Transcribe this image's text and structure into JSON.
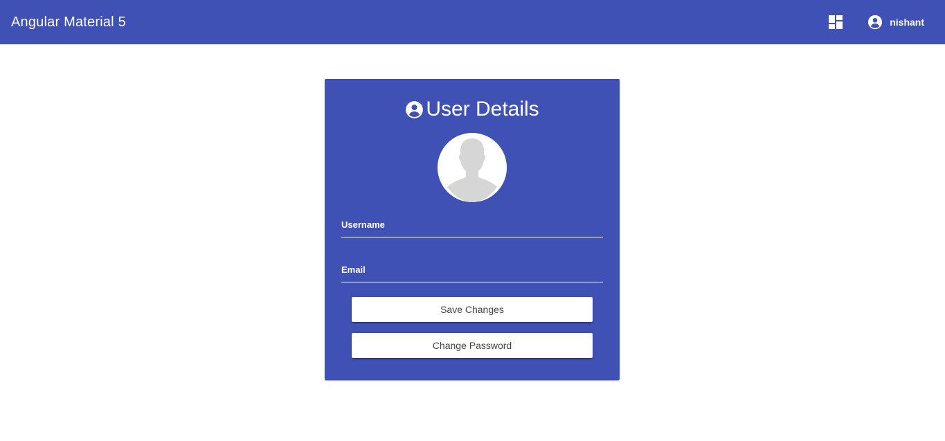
{
  "toolbar": {
    "title": "Angular Material 5",
    "user_name": "nishant",
    "icons": {
      "dashboard": "dashboard-icon",
      "account": "account-circle-icon"
    },
    "color": "#3f51b5"
  },
  "card": {
    "title": "User Details",
    "title_icon": "account-circle-icon",
    "avatar_icon": "default-avatar-icon",
    "fields": {
      "username": {
        "label": "Username",
        "value": ""
      },
      "email": {
        "label": "Email",
        "value": ""
      }
    },
    "buttons": {
      "save": "Save Changes",
      "change_password": "Change Password"
    },
    "color": "#3f51b5"
  }
}
